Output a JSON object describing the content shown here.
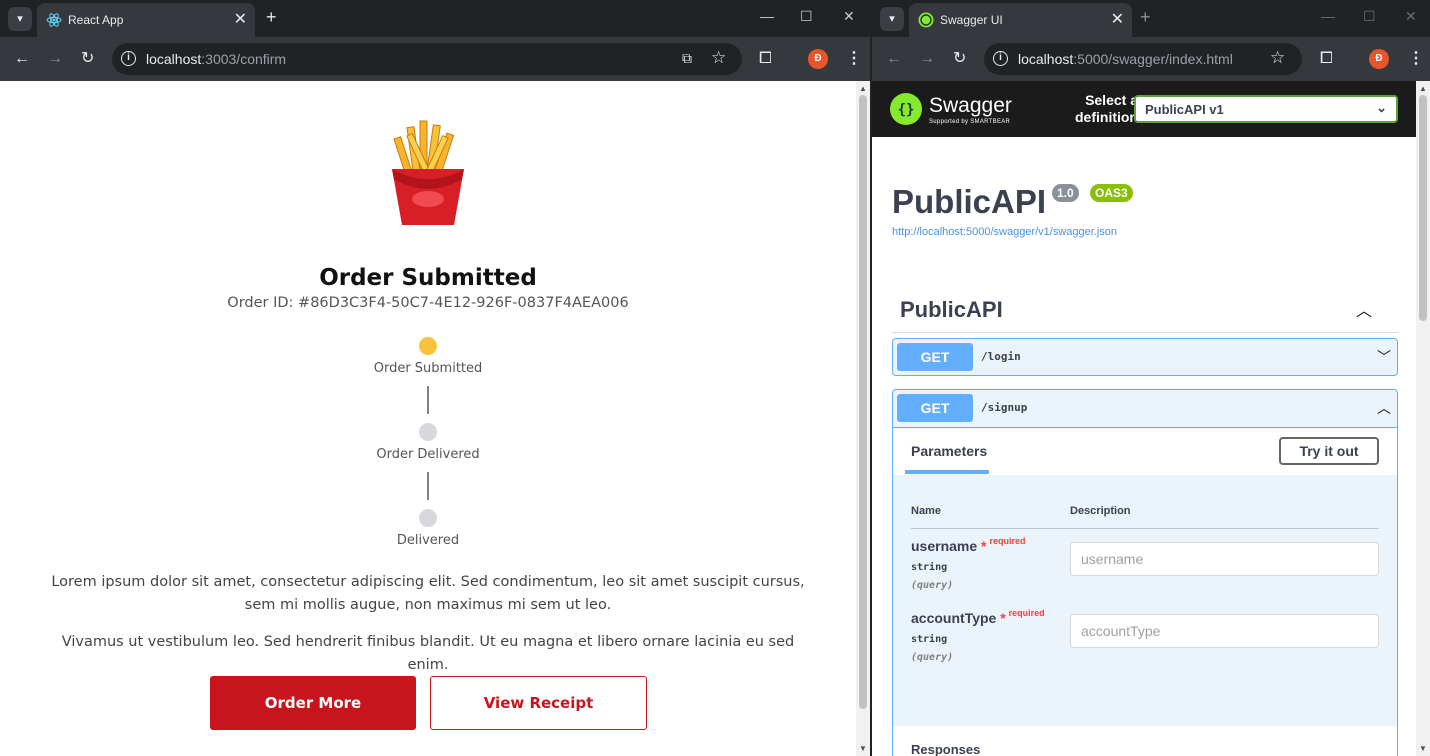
{
  "left": {
    "tab": {
      "title": "React App",
      "close": "✕",
      "new": "+"
    },
    "window": {
      "minimize": "—",
      "maximize": "☐",
      "close": "✕"
    },
    "nav": {
      "back": "←",
      "forward": "→",
      "reload": "↻"
    },
    "url": {
      "host": "localhost",
      "path": ":3003/confirm"
    },
    "toolbar": {
      "star": "☆",
      "avatar": "Đ",
      "menu": "⋮"
    },
    "page": {
      "heading": "Order Submitted",
      "order_id": "Order ID: #86D3C3F4-50C7-4E12-926F-0837F4AEA006",
      "steps": [
        {
          "label": "Order Submitted",
          "color": "#f9c23c"
        },
        {
          "label": "Order Delivered",
          "color": "#d6d8dc"
        },
        {
          "label": "Delivered",
          "color": "#d6d8dc"
        }
      ],
      "paragraph1": "Lorem ipsum dolor sit amet, consectetur adipiscing elit. Sed condimentum, leo sit amet suscipit cursus, sem mi mollis augue, non maximus mi sem ut leo.",
      "paragraph2": "Vivamus ut vestibulum leo. Sed hendrerit finibus blandit. Ut eu magna et libero ornare lacinia eu sed enim.",
      "order_more": "Order More",
      "view_receipt": "View Receipt",
      "accent": "#c8151d"
    }
  },
  "right": {
    "tab": {
      "title": "Swagger UI",
      "close": "✕",
      "new": "+"
    },
    "window": {
      "minimize": "—",
      "maximize": "☐",
      "close": "✕"
    },
    "url": {
      "host": "localhost",
      "path": ":5000/swagger/index.html"
    },
    "toolbar": {
      "avatar": "Đ"
    },
    "swagger": {
      "brand": "Swagger",
      "brand_sub": "Supported by SMARTBEAR",
      "select_label": "Select a definition",
      "selected_definition": "PublicAPI v1",
      "title": "PublicAPI",
      "version": "1.0",
      "oas": "OAS3",
      "spec_link": "http://localhost:5000/swagger/v1/swagger.json",
      "tag": "PublicAPI",
      "operations": [
        {
          "method": "GET",
          "path": "/login"
        },
        {
          "method": "GET",
          "path": "/signup"
        }
      ],
      "parameters_tab": "Parameters",
      "try_it_out": "Try it out",
      "col_name": "Name",
      "col_description": "Description",
      "params": [
        {
          "name": "username",
          "required": "required",
          "type": "string",
          "in": "(query)",
          "placeholder": "username"
        },
        {
          "name": "accountType",
          "required": "required",
          "type": "string",
          "in": "(query)",
          "placeholder": "accountType"
        }
      ],
      "responses": "Responses",
      "get_color": "#61affe"
    }
  }
}
